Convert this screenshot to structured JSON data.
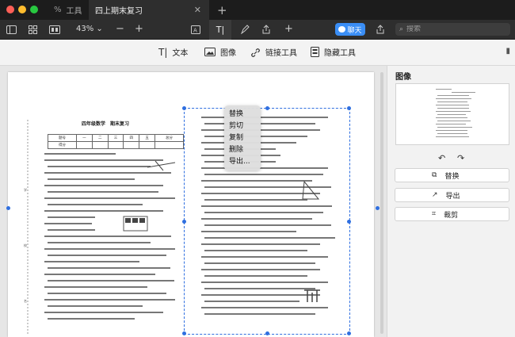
{
  "tabs": {
    "tools_label": "工具",
    "active_label": "四上期末复习",
    "close": "✕",
    "new": "+"
  },
  "toolbar": {
    "zoom": "43%",
    "zoom_out": "−",
    "zoom_in": "+",
    "text_mode": "T|",
    "chat_label": "聊天",
    "search_placeholder": "搜索"
  },
  "edit_toolbar": {
    "items": [
      {
        "icon": "text-icon",
        "label": "文本"
      },
      {
        "icon": "image-icon",
        "label": "图像"
      },
      {
        "icon": "link-icon",
        "label": "链接工具"
      },
      {
        "icon": "redact-icon",
        "label": "隐藏工具"
      }
    ]
  },
  "document": {
    "title": "四年级数学　期末复习",
    "score_header": [
      "题号",
      "一",
      "二",
      "三",
      "四",
      "五",
      "总分"
    ],
    "score_row_label": "得分"
  },
  "context_menu": {
    "items": [
      "替换",
      "剪切",
      "复制",
      "删除",
      "导出..."
    ]
  },
  "panel": {
    "title": "图像",
    "buttons": [
      {
        "icon": "replace-icon",
        "label": "替换"
      },
      {
        "icon": "export-icon",
        "label": "导出"
      },
      {
        "icon": "crop-icon",
        "label": "裁剪"
      }
    ]
  },
  "colors": {
    "accent": "#3a8ef6",
    "selection": "#2f6fe0"
  }
}
